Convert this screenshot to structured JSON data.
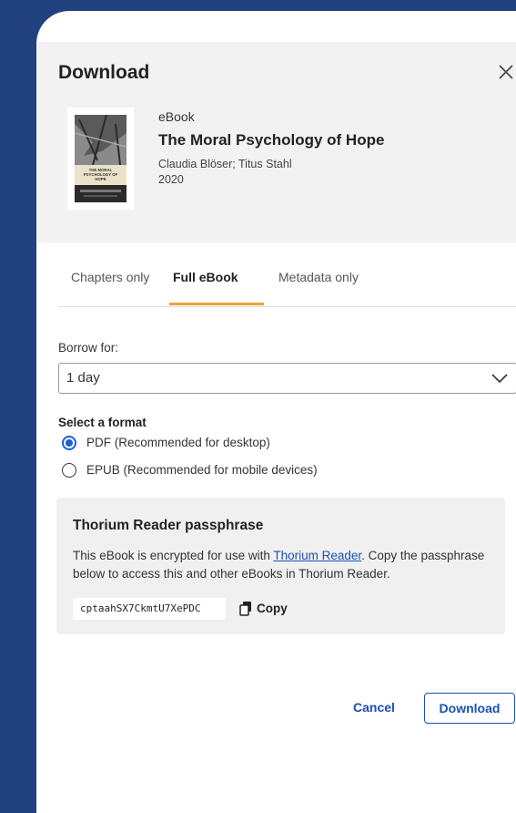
{
  "dialog": {
    "title": "Download",
    "close_icon": "close-icon"
  },
  "book": {
    "type": "eBook",
    "title": "The Moral Psychology of Hope",
    "authors": "Claudia Blöser; Titus Stahl",
    "year": "2020",
    "cover_text": [
      "THE MORAL",
      "PSYCHOLOGY OF",
      "HOPE"
    ]
  },
  "tabs": [
    {
      "label": "Chapters only",
      "active": false
    },
    {
      "label": "Full eBook",
      "active": true
    },
    {
      "label": "Metadata only",
      "active": false
    }
  ],
  "borrow": {
    "label": "Borrow for:",
    "selected": "1 day"
  },
  "format": {
    "label": "Select a format",
    "options": [
      {
        "label": "PDF (Recommended for desktop)",
        "checked": true
      },
      {
        "label": "EPUB (Recommended for mobile devices)",
        "checked": false
      }
    ]
  },
  "passphrase": {
    "title": "Thorium Reader passphrase",
    "desc_before": "This eBook is encrypted for use with ",
    "link": "Thorium Reader",
    "desc_after": ". Copy the passphrase below to access this and other eBooks in Thorium Reader.",
    "code": "cptaahSX7CkmtU7XePDC",
    "copy_label": "Copy"
  },
  "actions": {
    "cancel": "Cancel",
    "download": "Download"
  },
  "colors": {
    "background": "#22427f",
    "accent": "#1a4fb8",
    "tab_underline": "#f0a030",
    "radio_selected": "#1a5fd6"
  }
}
